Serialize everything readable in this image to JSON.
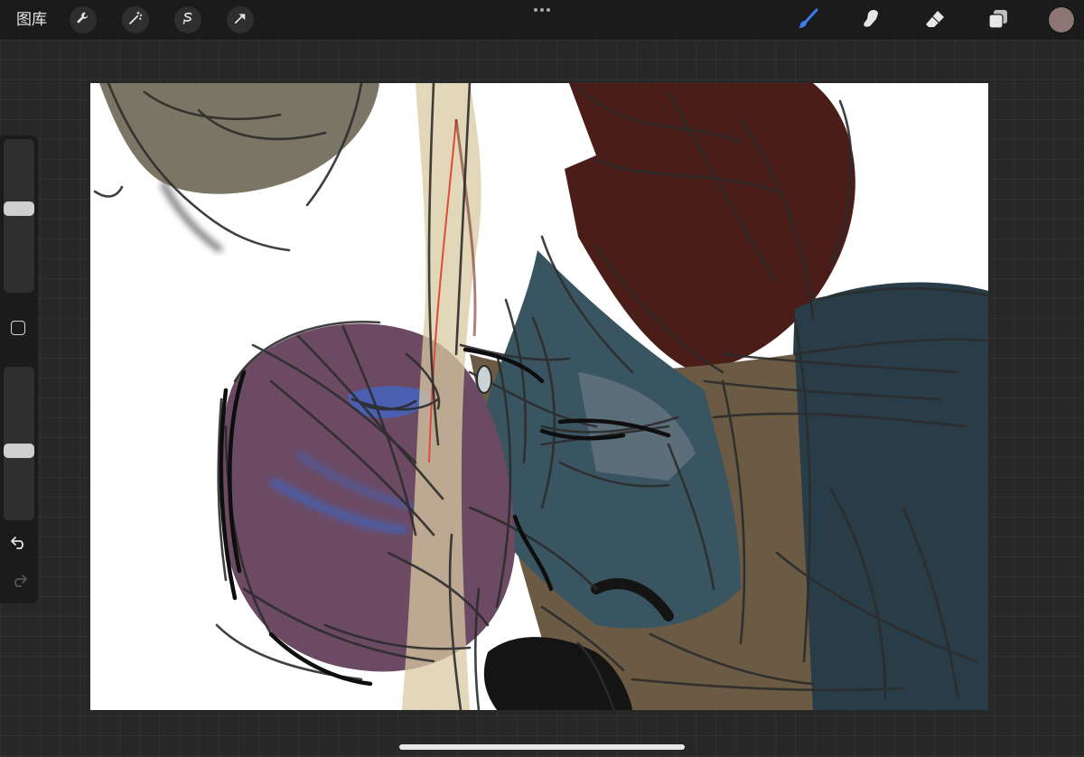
{
  "topbar": {
    "gallery_label": "图库",
    "left_tools": [
      {
        "icon": "wrench-icon",
        "name": "actions"
      },
      {
        "icon": "magic-wand-icon",
        "name": "adjustments"
      },
      {
        "icon": "selection-icon",
        "name": "selection"
      },
      {
        "icon": "arrow-cursor-icon",
        "name": "transform"
      }
    ],
    "right_tools": [
      {
        "icon": "brush-icon",
        "name": "paint",
        "active": true,
        "color": "#3b7bf5"
      },
      {
        "icon": "smudge-icon",
        "name": "smudge"
      },
      {
        "icon": "eraser-icon",
        "name": "erase"
      },
      {
        "icon": "layers-icon",
        "name": "layers"
      }
    ],
    "current_color": "#8c7674"
  },
  "sidebar": {
    "brush_size": 0.55,
    "opacity": 0.45
  }
}
